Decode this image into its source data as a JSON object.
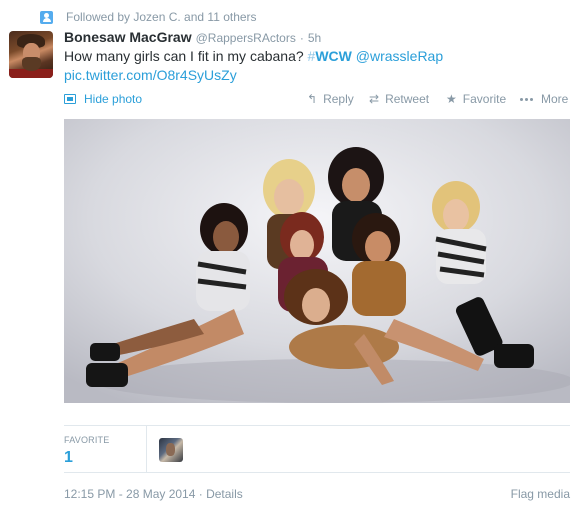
{
  "context": {
    "text": "Followed by Jozen C. and 11 others",
    "icon": "person-icon"
  },
  "tweet": {
    "fullname": "Bonesaw MacGraw",
    "username": "@RappersRActors",
    "separator": "·",
    "time": "5h",
    "text_prefix": "How many girls can I fit in my cabana?",
    "hashtag_symbol": "#",
    "hashtag": "WCW",
    "mention": "@wrassleRap",
    "link": "pic.twitter.com/O8r4SyUsZy"
  },
  "actions": {
    "hide_photo": "Hide photo",
    "reply": "Reply",
    "retweet": "Retweet",
    "favorite": "Favorite",
    "more": "More"
  },
  "stats": {
    "favorite_label": "FAVORITE",
    "favorite_count": "1"
  },
  "footer": {
    "date": "12:15 PM - 28 May 2014 · Details",
    "flag": "Flag media"
  },
  "colors": {
    "link": "#2b9fd9",
    "muted": "#8899a6",
    "text": "#292f33",
    "border": "#e1e8ed"
  }
}
